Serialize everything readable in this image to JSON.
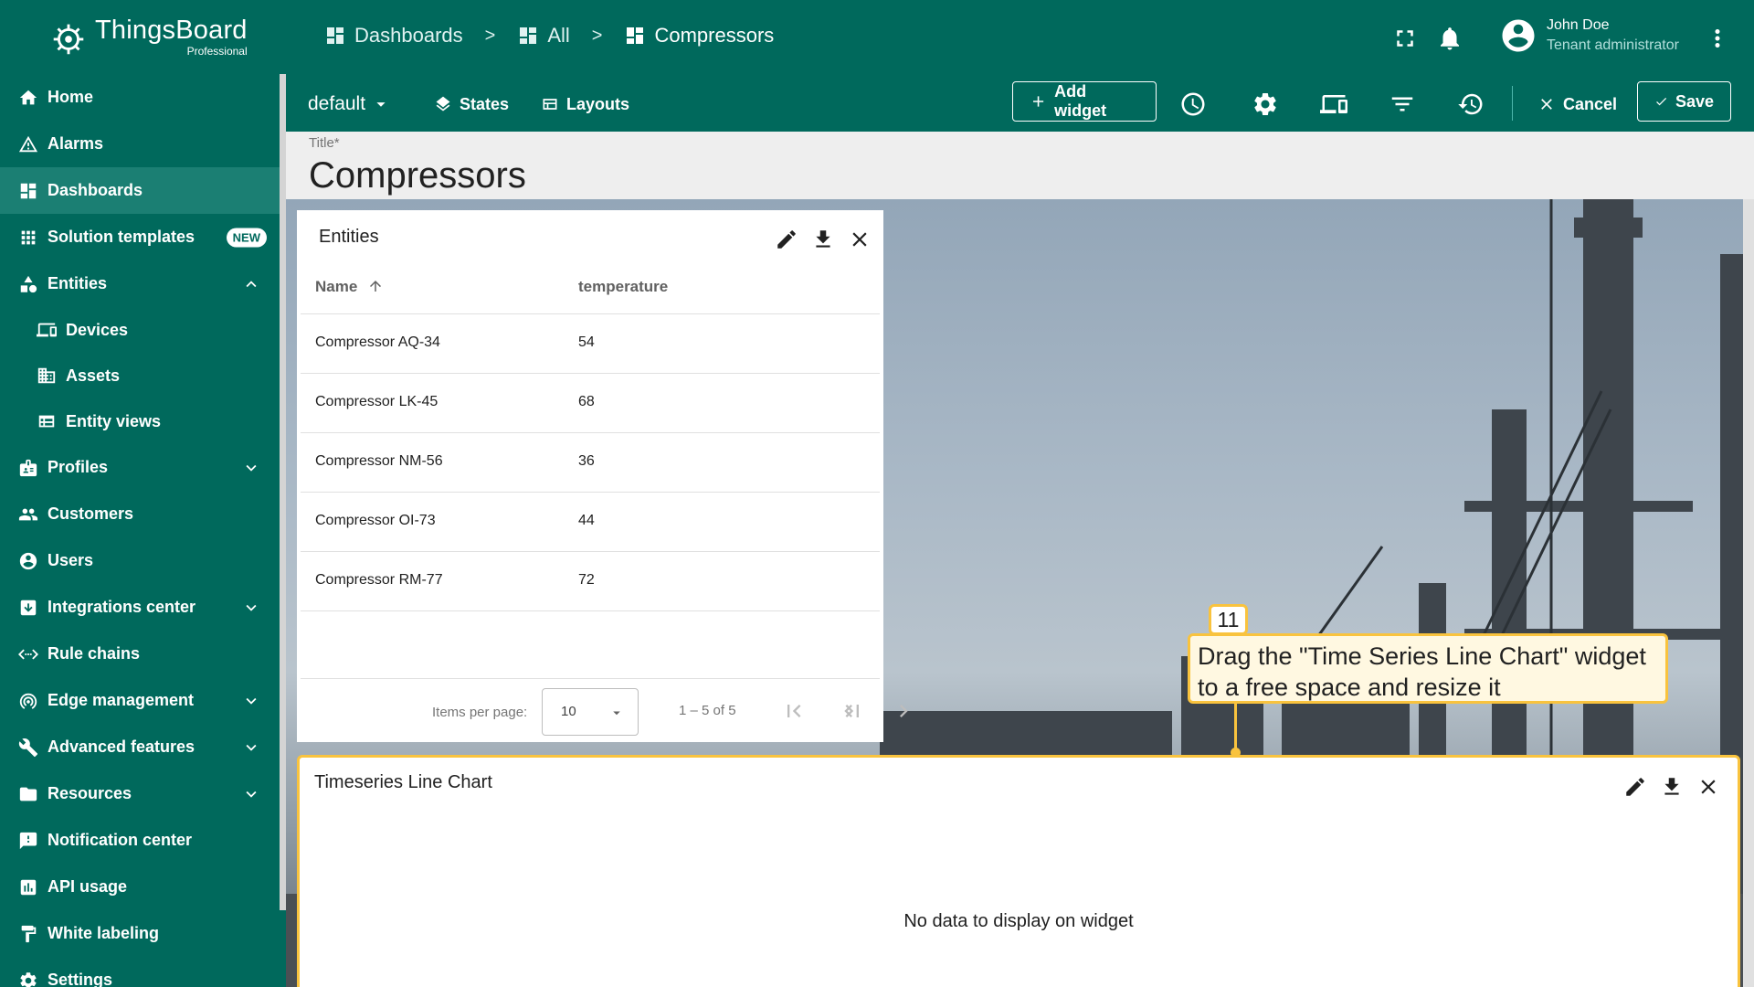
{
  "app": {
    "name": "ThingsBoard",
    "edition": "Professional"
  },
  "sidebar": {
    "items": [
      {
        "label": "Home",
        "icon": "home-icon"
      },
      {
        "label": "Alarms",
        "icon": "alarm-icon"
      },
      {
        "label": "Dashboards",
        "icon": "dashboard-icon",
        "active": true
      },
      {
        "label": "Solution templates",
        "icon": "apps-icon",
        "badge": "NEW"
      },
      {
        "label": "Entities",
        "icon": "entities-icon",
        "expanded": true
      },
      {
        "label": "Devices",
        "icon": "devices-icon",
        "sub": true
      },
      {
        "label": "Assets",
        "icon": "assets-icon",
        "sub": true
      },
      {
        "label": "Entity views",
        "icon": "entity-views-icon",
        "sub": true
      },
      {
        "label": "Profiles",
        "icon": "profiles-icon"
      },
      {
        "label": "Customers",
        "icon": "customers-icon"
      },
      {
        "label": "Users",
        "icon": "users-icon"
      },
      {
        "label": "Integrations center",
        "icon": "integrations-icon"
      },
      {
        "label": "Rule chains",
        "icon": "rule-chains-icon"
      },
      {
        "label": "Edge management",
        "icon": "edge-icon"
      },
      {
        "label": "Advanced features",
        "icon": "advanced-icon"
      },
      {
        "label": "Resources",
        "icon": "folder-icon"
      },
      {
        "label": "Notification center",
        "icon": "notification-icon"
      },
      {
        "label": "API usage",
        "icon": "api-usage-icon"
      },
      {
        "label": "White labeling",
        "icon": "paint-roller-icon"
      },
      {
        "label": "Settings",
        "icon": "gear-icon"
      }
    ]
  },
  "breadcrumb": {
    "items": [
      "Dashboards",
      "All",
      "Compressors"
    ],
    "separator": ">"
  },
  "user": {
    "name": "John Doe",
    "role": "Tenant administrator"
  },
  "toolbar": {
    "layout_select": "default",
    "states_label": "States",
    "layouts_label": "Layouts",
    "add_widget_label": "Add widget",
    "cancel_label": "Cancel",
    "save_label": "Save"
  },
  "dashboard": {
    "title_label": "Title*",
    "title": "Compressors"
  },
  "entities_widget": {
    "title": "Entities",
    "columns": [
      "Name",
      "temperature"
    ],
    "rows": [
      {
        "name": "Compressor AQ-34",
        "temperature": "54"
      },
      {
        "name": "Compressor LK-45",
        "temperature": "68"
      },
      {
        "name": "Compressor NM-56",
        "temperature": "36"
      },
      {
        "name": "Compressor OI-73",
        "temperature": "44"
      },
      {
        "name": "Compressor RM-77",
        "temperature": "72"
      }
    ],
    "paginator": {
      "items_per_page_label": "Items per page:",
      "page_size": "10",
      "range": "1 – 5 of 5"
    }
  },
  "chart_widget": {
    "title": "Timeseries Line Chart",
    "empty_message": "No data to display on widget"
  },
  "callout": {
    "step": "11",
    "text": "Drag the \"Time Series Line Chart\" widget to a free space and resize it"
  },
  "colors": {
    "primary": "#00695c",
    "primary_active": "#1b7f73",
    "highlight": "#f9c33e"
  }
}
